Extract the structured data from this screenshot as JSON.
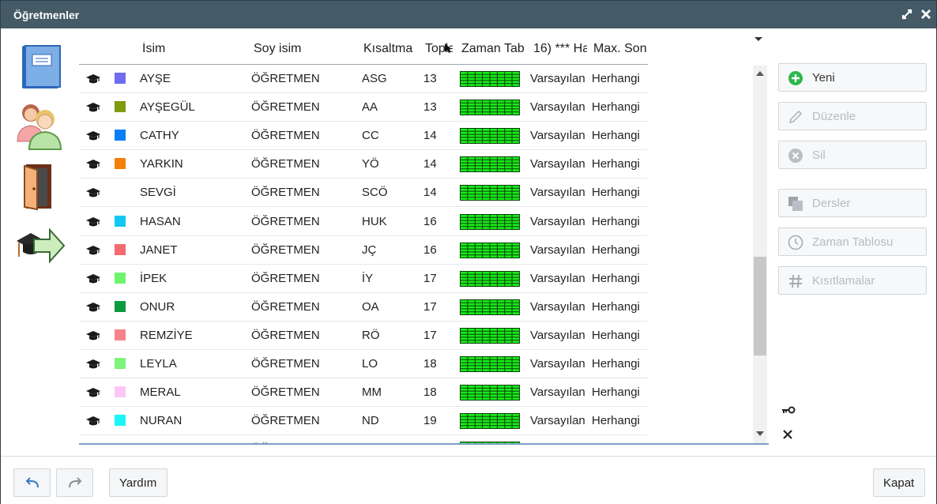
{
  "window": {
    "title": "Öğretmenler"
  },
  "columns": [
    "İsim",
    "Soy isim",
    "Kısaltma",
    "Toplam",
    "Zaman Tablosu",
    "16) *** Ha",
    "Max. Son"
  ],
  "rows": [
    {
      "name": "AYŞE",
      "surname": "ÖĞRETMEN",
      "abbr": "ASG",
      "total": "13",
      "avail": "Varsayılan",
      "max": "Herhangi",
      "color": "#6f6cf2"
    },
    {
      "name": "AYŞEGÜL",
      "surname": "ÖĞRETMEN",
      "abbr": "AA",
      "total": "13",
      "avail": "Varsayılan",
      "max": "Herhangi",
      "color": "#7f9b0f"
    },
    {
      "name": "CATHY",
      "surname": "ÖĞRETMEN",
      "abbr": "CC",
      "total": "14",
      "avail": "Varsayılan",
      "max": "Herhangi",
      "color": "#0b7ef6"
    },
    {
      "name": "YARKIN",
      "surname": "ÖĞRETMEN",
      "abbr": "YÖ",
      "total": "14",
      "avail": "Varsayılan",
      "max": "Herhangi",
      "color": "#f57f0b"
    },
    {
      "name": "SEVGİ",
      "surname": "ÖĞRETMEN",
      "abbr": "SCÖ",
      "total": "14",
      "avail": "Varsayılan",
      "max": "Herhangi",
      "color": ""
    },
    {
      "name": "HASAN",
      "surname": "ÖĞRETMEN",
      "abbr": "HUK",
      "total": "16",
      "avail": "Varsayılan",
      "max": "Herhangi",
      "color": "#12c8f5"
    },
    {
      "name": "JANET",
      "surname": "ÖĞRETMEN",
      "abbr": "JÇ",
      "total": "16",
      "avail": "Varsayılan",
      "max": "Herhangi",
      "color": "#f46a6f"
    },
    {
      "name": "İPEK",
      "surname": "ÖĞRETMEN",
      "abbr": "İY",
      "total": "17",
      "avail": "Varsayılan",
      "max": "Herhangi",
      "color": "#6ef56c"
    },
    {
      "name": "ONUR",
      "surname": "ÖĞRETMEN",
      "abbr": "OA",
      "total": "17",
      "avail": "Varsayılan",
      "max": "Herhangi",
      "color": "#0c9a3e"
    },
    {
      "name": "REMZİYE",
      "surname": "ÖĞRETMEN",
      "abbr": "RÖ",
      "total": "17",
      "avail": "Varsayılan",
      "max": "Herhangi",
      "color": "#f58389"
    },
    {
      "name": "LEYLA",
      "surname": "ÖĞRETMEN",
      "abbr": "LO",
      "total": "18",
      "avail": "Varsayılan",
      "max": "Herhangi",
      "color": "#7cf57a"
    },
    {
      "name": "MERAL",
      "surname": "ÖĞRETMEN",
      "abbr": "MM",
      "total": "18",
      "avail": "Varsayılan",
      "max": "Herhangi",
      "color": "#fdc6f5"
    },
    {
      "name": "NURAN",
      "surname": "ÖĞRETMEN",
      "abbr": "ND",
      "total": "19",
      "avail": "Varsayılan",
      "max": "Herhangi",
      "color": "#1cf5f5"
    },
    {
      "name": "",
      "surname": "ÖĞRETMEN",
      "abbr": "",
      "total": "",
      "avail": "",
      "max": "",
      "color": "#8b8b2a"
    }
  ],
  "actions": [
    {
      "label": "Yeni",
      "enabled": true,
      "icon": "plus-circle-icon"
    },
    {
      "label": "Düzenle",
      "enabled": false,
      "icon": "pencil-icon"
    },
    {
      "label": "Sil",
      "enabled": false,
      "icon": "delete-circle-icon"
    },
    {
      "label": "Dersler",
      "enabled": false,
      "icon": "copy-icon"
    },
    {
      "label": "Zaman Tablosu",
      "enabled": false,
      "icon": "clock-icon"
    },
    {
      "label": "Kısıtlamalar",
      "enabled": false,
      "icon": "hash-icon"
    }
  ],
  "footer": {
    "help": "Yardım",
    "close": "Kapat"
  },
  "colors": {
    "titlebar": "#445a66",
    "timetable_green": "#18ee18",
    "accent_green": "#2db84c"
  }
}
